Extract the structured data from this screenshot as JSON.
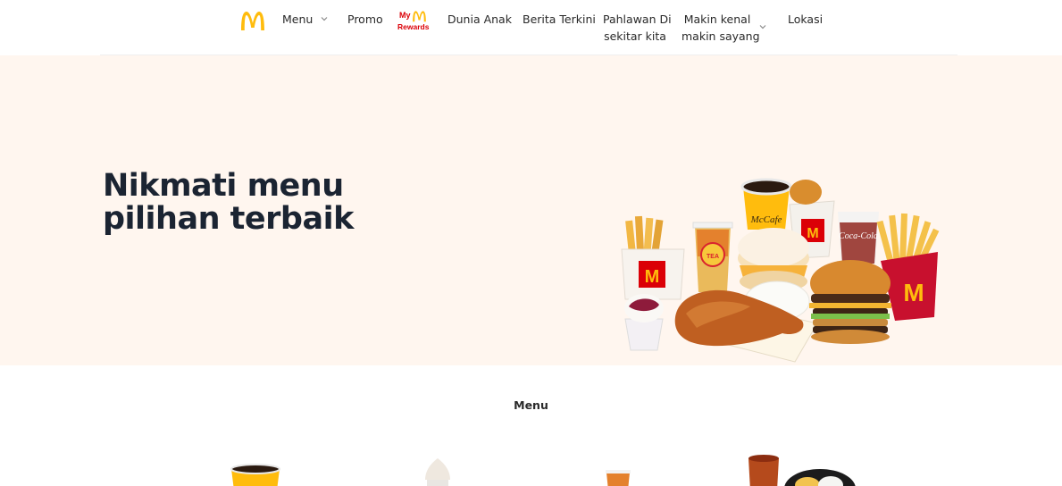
{
  "nav": {
    "items": [
      {
        "label": "Menu"
      },
      {
        "label": "Promo"
      },
      {
        "label": "Dunia Anak"
      },
      {
        "label": "Berita Terkini"
      },
      {
        "label_line1": "Pahlawan Di",
        "label_line2": "sekitar kita"
      },
      {
        "label_line1": "Makin kenal",
        "label_line2": "makin sayang"
      },
      {
        "label": "Lokasi"
      }
    ],
    "rewards": {
      "my": "My",
      "rewards": "Rewards"
    }
  },
  "hero": {
    "title_line1": "Nikmati menu",
    "title_line2": "pilihan terbaik"
  },
  "menu_section": {
    "title": "Menu"
  },
  "colors": {
    "brand_yellow": "#ffbc0d",
    "brand_red": "#db0007",
    "hero_bg": "#fff6ef",
    "heading": "#1b2432"
  },
  "icons": [
    "golden-arches-logo",
    "chevron-down-icon"
  ]
}
